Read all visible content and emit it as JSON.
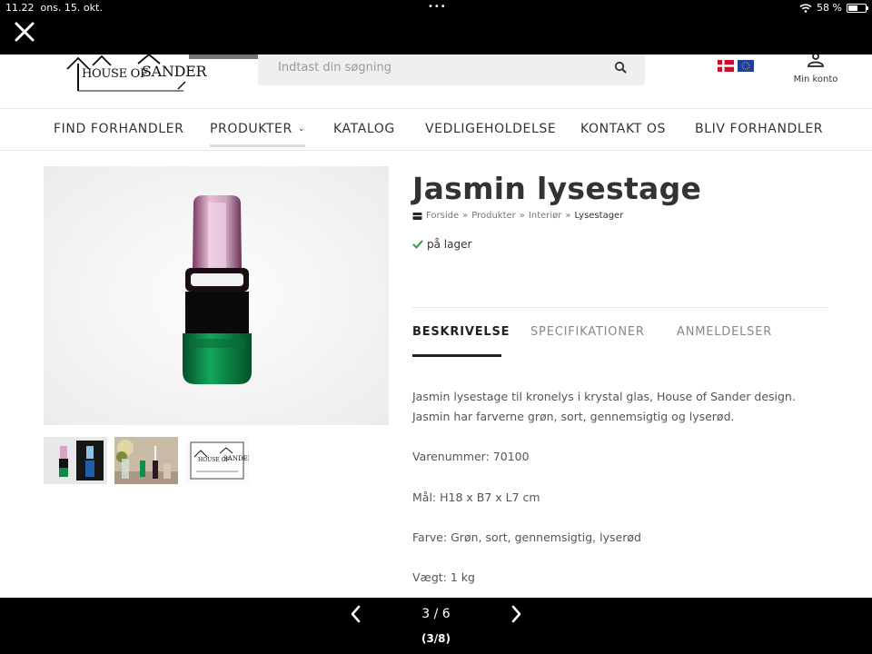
{
  "status_bar": {
    "time": "11.22",
    "date": "ons. 15. okt.",
    "dots": "•••",
    "battery": "58 %",
    "battery_level": 0.58
  },
  "viewer": {
    "counter": "3 / 6",
    "subcounter": "(3/8)"
  },
  "header": {
    "logo_text_left": "HOUSE OF",
    "logo_text_right": "SANDER",
    "search_placeholder": "Indtast din søgning",
    "account_label": "Min konto"
  },
  "nav": {
    "items": [
      "FIND FORHANDLER",
      "PRODUKTER",
      "KATALOG",
      "VEDLIGEHOLDELSE",
      "KONTAKT OS",
      "BLIV FORHANDLER"
    ]
  },
  "product": {
    "title": "Jasmin lysestage",
    "breadcrumb": [
      "Forside",
      "Produkter",
      "Interiør",
      "Lysestager"
    ],
    "breadcrumb_sep": "»",
    "stock": "på lager",
    "tabs": [
      "BESKRIVELSE",
      "SPECIFIKATIONER",
      "ANMELDELSER"
    ],
    "description": "Jasmin lysestage til kronelys i krystal glas, House of Sander design. Jasmin har farverne grøn, sort, gennemsigtig og lyserød.",
    "item_number": "Varenummer: 70100",
    "dimensions": "Mål: H18 x B7 x L7 cm",
    "color": "Farve: Grøn, sort, gennemsigtig, lyserød",
    "weight": "Vægt: 1 kg"
  },
  "thumbnails": {
    "logo_text_left": "HOUSE OF",
    "logo_text_right": "SANDER"
  },
  "colors": {
    "accent_green": "#2aa04a",
    "glass_green": "#0e8f4a",
    "glass_pink": "#d9a9c9"
  }
}
